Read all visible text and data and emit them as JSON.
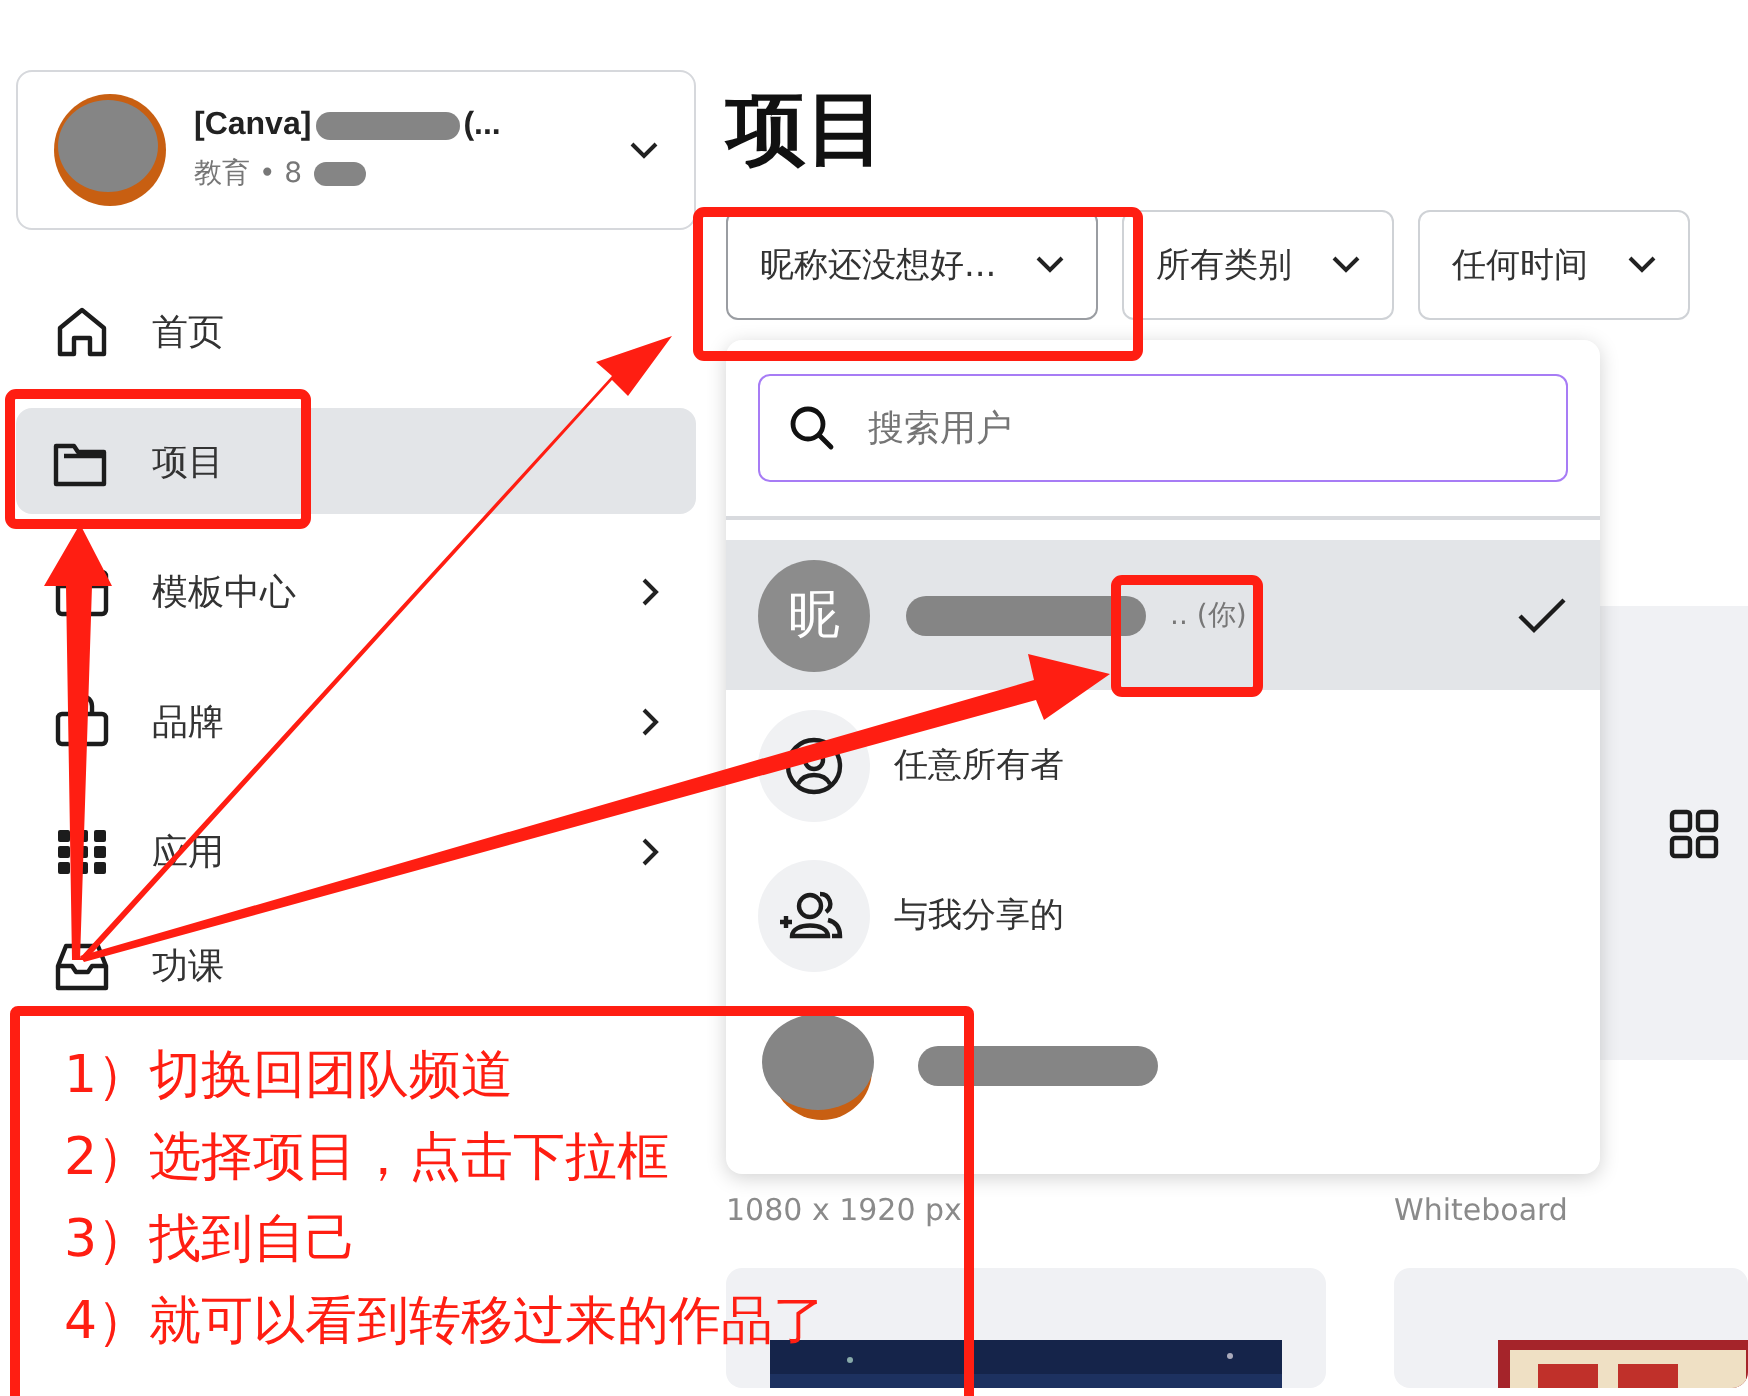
{
  "sidebar": {
    "team": {
      "name_start": "[Canva]",
      "name_end": "(...",
      "subtitle": "教育 • 8"
    },
    "items": [
      {
        "kind": "home",
        "label": "首页",
        "selected": false,
        "submenu": false
      },
      {
        "kind": "folder",
        "label": "项目",
        "selected": true,
        "submenu": false
      },
      {
        "kind": "template",
        "label": "模板中心",
        "selected": false,
        "submenu": true
      },
      {
        "kind": "brand",
        "label": "品牌",
        "selected": false,
        "submenu": true
      },
      {
        "kind": "apps",
        "label": "应用",
        "selected": false,
        "submenu": true
      },
      {
        "kind": "inbox",
        "label": "功课",
        "selected": false,
        "submenu": false
      }
    ]
  },
  "page_title": "项目",
  "filters": [
    {
      "label": "昵称还没想好...",
      "open": true
    },
    {
      "label": "所有类别",
      "open": false
    },
    {
      "label": "任何时间",
      "open": false
    }
  ],
  "owner_menu": {
    "search": {
      "placeholder": "搜索用户"
    },
    "options": [
      {
        "kind": "me",
        "avatar_text": "昵",
        "label": ".. (你)",
        "selected": true
      },
      {
        "kind": "any",
        "label": "任意所有者",
        "selected": false
      },
      {
        "kind": "shared",
        "label": "与我分享的",
        "selected": false
      },
      {
        "kind": "hidden",
        "selected": false
      }
    ]
  },
  "cards": [
    {
      "caption": "1080 x 1920 px"
    },
    {
      "caption": "Whiteboard"
    }
  ],
  "annotation": {
    "steps": [
      "1）切换回团队频道",
      "2）选择项目，点击下拉框",
      "3）找到自己",
      "4）就可以看到转移过来的作品了"
    ]
  }
}
